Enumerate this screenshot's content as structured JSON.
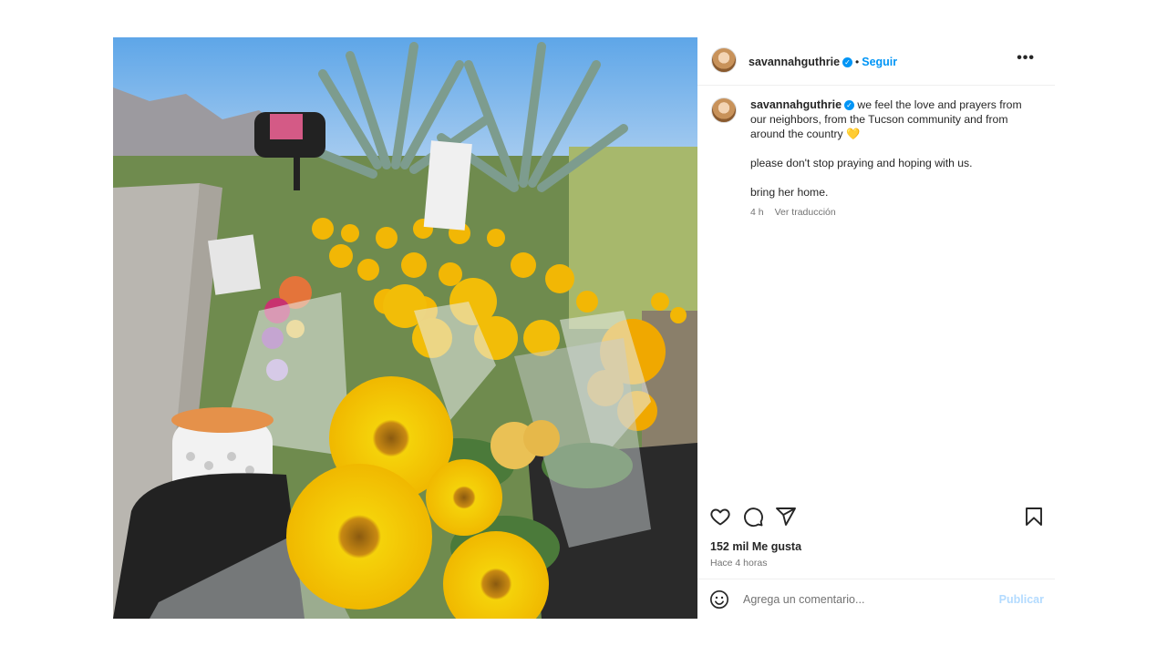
{
  "post": {
    "username": "savannahguthrie",
    "follow_label": "Seguir",
    "dot": "•",
    "more_label": "•••",
    "caption": {
      "line1": "we feel the love and prayers from our neighbors, from the Tucson community and from around the country 💛",
      "line2": "please don't stop praying and hoping with us.",
      "line3": "bring her home."
    },
    "caption_age": "4 h",
    "translate_label": "Ver traducción",
    "likes": "152 mil Me gusta",
    "time_ago": "Hace 4 horas",
    "comment_placeholder": "Agrega un comentario...",
    "publish_label": "Publicar"
  },
  "icons": {
    "like": "heart-icon",
    "comment": "comment-icon",
    "share": "share-icon",
    "save": "bookmark-icon",
    "emoji": "emoji-icon",
    "verified": "verified-badge-icon"
  },
  "colors": {
    "accent": "#0095f6",
    "publish_disabled": "#b3dbff",
    "muted": "#737373"
  }
}
